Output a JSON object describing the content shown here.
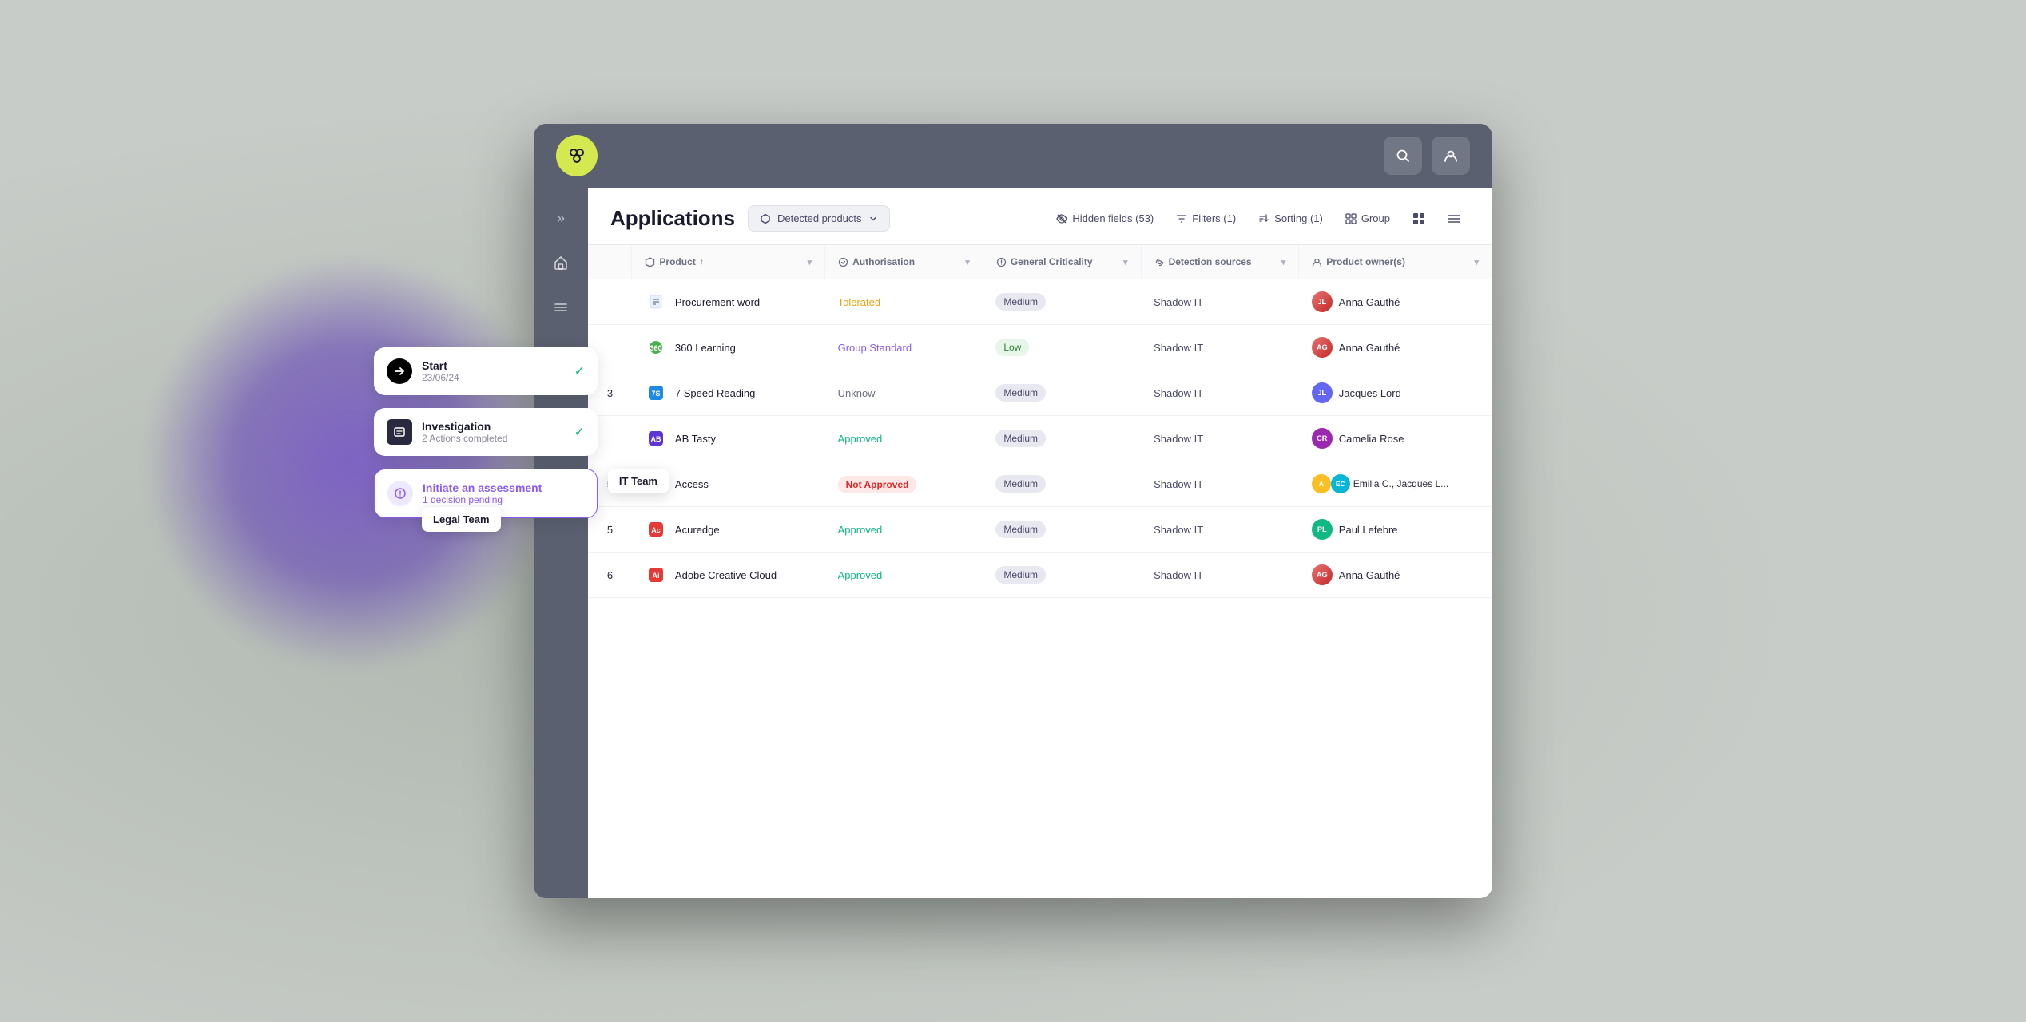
{
  "browser": {
    "logo": "✦",
    "header_search_label": "Search",
    "header_user_label": "User"
  },
  "sidebar": {
    "items": [
      {
        "icon": "»",
        "label": "Expand"
      },
      {
        "icon": "⌂",
        "label": "Home"
      },
      {
        "icon": "☰",
        "label": "Menu"
      }
    ]
  },
  "page": {
    "title": "Applications",
    "detected_products_btn": "Detected products",
    "toolbar": {
      "hidden_fields": "Hidden fields (53)",
      "filters": "Filters (1)",
      "sorting": "Sorting (1)",
      "group": "Group"
    }
  },
  "table": {
    "columns": [
      {
        "id": "num",
        "label": ""
      },
      {
        "id": "product",
        "label": "Product",
        "icon": "shield",
        "sort": true
      },
      {
        "id": "auth",
        "label": "Authorisation",
        "icon": "check-circle"
      },
      {
        "id": "criticality",
        "label": "General Criticality",
        "icon": "alert-circle"
      },
      {
        "id": "detection",
        "label": "Detection sources",
        "icon": "radar"
      },
      {
        "id": "owner",
        "label": "Product owner(s)",
        "icon": "user"
      }
    ],
    "rows": [
      {
        "num": "",
        "product_name": "Procurement word",
        "product_icon_emoji": "📋",
        "product_icon_bg": "#e8f0ff",
        "auth": "Tolerated",
        "auth_class": "tolerated",
        "criticality": "Medium",
        "criticality_class": "medium",
        "detection": "Shadow IT",
        "owners": [
          {
            "initials": "JL",
            "bg": "#6366f1",
            "name": "Anna Gauthé"
          }
        ],
        "owner_display": "Anna Gauthé"
      },
      {
        "num": "",
        "product_name": "360 Learning",
        "product_icon_emoji": "🎯",
        "product_icon_bg": "#fff3e0",
        "auth": "Group Standard",
        "auth_class": "group-standard",
        "criticality": "Low",
        "criticality_class": "low",
        "detection": "Shadow IT",
        "owners": [
          {
            "initials": "AG",
            "bg": "#e57373",
            "name": "Anna Gauthé"
          }
        ],
        "owner_display": "Anna Gauthé"
      },
      {
        "num": "3",
        "product_name": "7 Speed Reading",
        "product_icon_emoji": "📖",
        "product_icon_bg": "#e3f2fd",
        "auth": "Unknow",
        "auth_class": "unknown",
        "criticality": "Medium",
        "criticality_class": "medium",
        "detection": "Shadow IT",
        "owners": [
          {
            "initials": "JL",
            "bg": "#6366f1",
            "name": "Jacques Lord"
          }
        ],
        "owner_display": "Jacques Lord"
      },
      {
        "num": "",
        "product_name": "AB Tasty",
        "product_icon_emoji": "🅰",
        "product_icon_bg": "#f3e5f5",
        "auth": "Approved",
        "auth_class": "approved",
        "criticality": "Medium",
        "criticality_class": "medium",
        "detection": "Shadow IT",
        "owners": [
          {
            "initials": "CR",
            "bg": "#9c27b0",
            "name": "Camelia Rose"
          }
        ],
        "owner_display": "Camelia Rose"
      },
      {
        "num": "5",
        "product_name": "Access",
        "product_icon_emoji": "🅰",
        "product_icon_bg": "#ffebee",
        "auth": "Not Approved",
        "auth_class": "not-approved",
        "criticality": "Medium",
        "criticality_class": "medium",
        "detection": "Shadow IT",
        "owners": [
          {
            "initials": "A",
            "bg": "#fbbf24",
            "name": "Emilia C."
          },
          {
            "initials": "EC",
            "bg": "#06b6d4",
            "name": "Jacques L."
          }
        ],
        "owner_display": "Emilia C., Jacques L..."
      },
      {
        "num": "5",
        "product_name": "Acuredge",
        "product_icon_emoji": "📊",
        "product_icon_bg": "#fce4ec",
        "auth": "Approved",
        "auth_class": "approved",
        "criticality": "Medium",
        "criticality_class": "medium",
        "detection": "Shadow IT",
        "owners": [
          {
            "initials": "PL",
            "bg": "#10b981",
            "name": "Paul Lefebre"
          }
        ],
        "owner_display": "Paul Lefebre"
      },
      {
        "num": "6",
        "product_name": "Adobe Creative Cloud",
        "product_icon_emoji": "☁",
        "product_icon_bg": "#ffebee",
        "auth": "Approved",
        "auth_class": "approved",
        "criticality": "Medium",
        "criticality_class": "medium",
        "detection": "Shadow IT",
        "owners": [
          {
            "initials": "AG",
            "bg": "#e57373",
            "name": "Anna Gauthé"
          }
        ],
        "owner_display": "Anna Gauthé"
      }
    ]
  },
  "workflow_cards": {
    "start": {
      "title": "Start",
      "subtitle": "23/06/24"
    },
    "investigation": {
      "title": "Investigation",
      "subtitle": "2 Actions completed"
    },
    "assessment": {
      "title": "Initiate an assessment",
      "subtitle": "1 decision pending"
    }
  },
  "labels": {
    "it_team": "IT Team",
    "legal_team": "Legal Team"
  }
}
